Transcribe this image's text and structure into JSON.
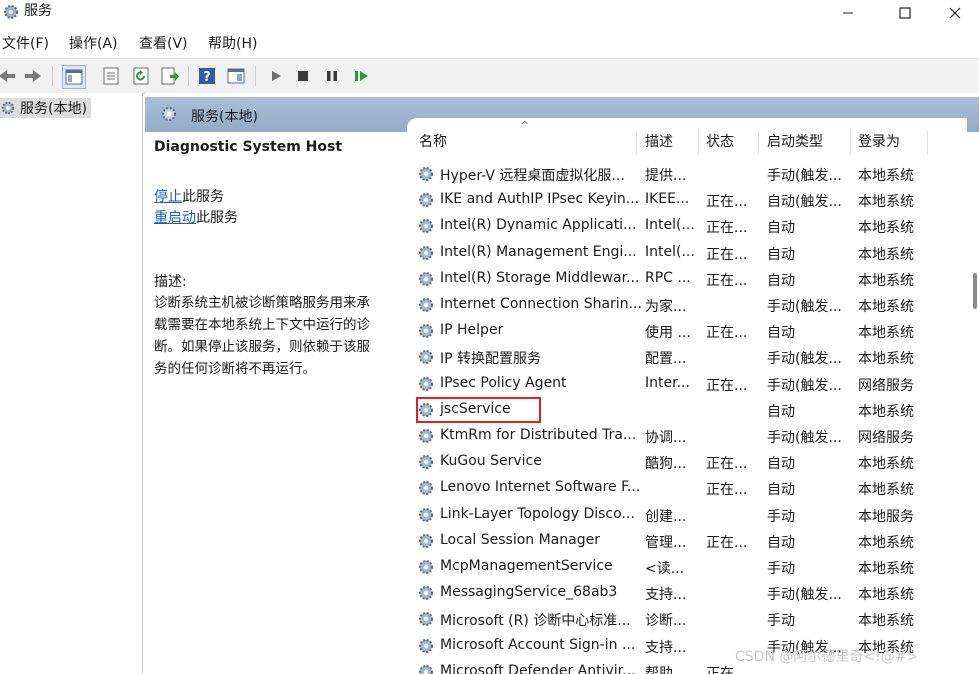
{
  "window": {
    "title": "服务",
    "controls": [
      "minimize",
      "maximize",
      "close"
    ]
  },
  "menu": [
    "文件(F)",
    "操作(A)",
    "查看(V)",
    "帮助(H)"
  ],
  "tree": {
    "item": "服务(本地)"
  },
  "panel": {
    "header": "服务(本地)"
  },
  "details": {
    "service_name": "Diagnostic System Host",
    "stop_link": "停止",
    "stop_suffix": "此服务",
    "restart_link": "重启动",
    "restart_suffix": "此服务",
    "desc_label": "描述:",
    "desc_lines": [
      "诊断系统主机被诊断策略服务用来承",
      "载需要在本地系统上下文中运行的诊",
      "断。如果停止该服务，则依赖于该服",
      "务的任何诊断将不再运行。"
    ]
  },
  "columns": [
    "名称",
    "描述",
    "状态",
    "启动类型",
    "登录为"
  ],
  "sort_indicator": "^",
  "services": [
    {
      "name": "Hyper-V 远程桌面虚拟化服...",
      "desc": "提供...",
      "status": "",
      "startup": "手动(触发...",
      "logon": "本地系统"
    },
    {
      "name": "IKE and AuthIP IPsec Keyin...",
      "desc": "IKEE...",
      "status": "正在...",
      "startup": "自动(触发...",
      "logon": "本地系统"
    },
    {
      "name": "Intel(R) Dynamic Applicati...",
      "desc": "Intel(...",
      "status": "正在...",
      "startup": "自动",
      "logon": "本地系统"
    },
    {
      "name": "Intel(R) Management Engi...",
      "desc": "Intel(...",
      "status": "正在...",
      "startup": "自动",
      "logon": "本地系统"
    },
    {
      "name": "Intel(R) Storage Middlewar...",
      "desc": "RPC ...",
      "status": "正在...",
      "startup": "自动",
      "logon": "本地系统"
    },
    {
      "name": "Internet Connection Sharin...",
      "desc": "为家...",
      "status": "",
      "startup": "手动(触发...",
      "logon": "本地系统"
    },
    {
      "name": "IP Helper",
      "desc": "使用 ...",
      "status": "正在...",
      "startup": "自动",
      "logon": "本地系统"
    },
    {
      "name": "IP 转换配置服务",
      "desc": "配置...",
      "status": "",
      "startup": "手动(触发...",
      "logon": "本地系统"
    },
    {
      "name": "IPsec Policy Agent",
      "desc": "Inter...",
      "status": "正在...",
      "startup": "手动(触发...",
      "logon": "网络服务"
    },
    {
      "name": "jscService",
      "desc": "",
      "status": "",
      "startup": "自动",
      "logon": "本地系统"
    },
    {
      "name": "KtmRm for Distributed Tra...",
      "desc": "协调...",
      "status": "",
      "startup": "手动(触发...",
      "logon": "网络服务"
    },
    {
      "name": "KuGou Service",
      "desc": "酷狗...",
      "status": "正在...",
      "startup": "自动",
      "logon": "本地系统"
    },
    {
      "name": "Lenovo Internet Software F...",
      "desc": "",
      "status": "正在...",
      "startup": "自动",
      "logon": "本地系统"
    },
    {
      "name": "Link-Layer Topology Disco...",
      "desc": "创建...",
      "status": "",
      "startup": "手动",
      "logon": "本地服务"
    },
    {
      "name": "Local Session Manager",
      "desc": "管理...",
      "status": "正在...",
      "startup": "自动",
      "logon": "本地系统"
    },
    {
      "name": "McpManagementService",
      "desc": "<读...",
      "status": "",
      "startup": "手动",
      "logon": "本地系统"
    },
    {
      "name": "MessagingService_68ab3",
      "desc": "支持...",
      "status": "",
      "startup": "手动(触发...",
      "logon": "本地系统"
    },
    {
      "name": "Microsoft (R) 诊断中心标准...",
      "desc": "诊断...",
      "status": "",
      "startup": "手动",
      "logon": "本地系统"
    },
    {
      "name": "Microsoft Account Sign-in ...",
      "desc": "支持...",
      "status": "",
      "startup": "手动(触发...",
      "logon": "本地系统"
    },
    {
      "name": "Microsoft Defender Antivir...",
      "desc": "帮助...",
      "status": "正在...",
      "startup": "",
      "logon": ""
    }
  ],
  "highlighted_service": "jscService",
  "watermark": "CSDN @阿尔德里奇<!@#>"
}
